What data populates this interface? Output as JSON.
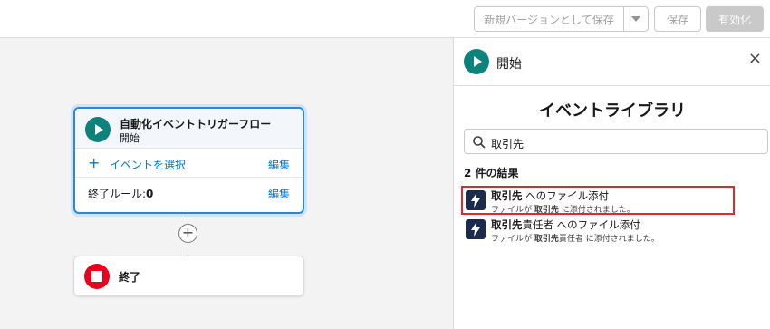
{
  "toolbar": {
    "new_version_label": "新規バージョンとして保存",
    "save_label": "保存",
    "activate_label": "有効化"
  },
  "canvas": {
    "start_node": {
      "title": "自動化イベントトリガーフロー",
      "subtitle": "開始",
      "select_event_label": "イベントを選択",
      "edit_label_1": "編集",
      "end_rule_label": "終了ルール:",
      "end_rule_value": "0",
      "edit_label_2": "編集"
    },
    "add_symbol": "+",
    "end_node": {
      "label": "終了"
    }
  },
  "panel": {
    "title": "開始",
    "close_symbol": "×",
    "library_title": "イベントライブラリ",
    "search_value": "取引先",
    "results_count": "2 件の結果",
    "results": [
      {
        "title_bold": "取引先",
        "title_rest": " へのファイル添付",
        "sub_pre": "ファイルが ",
        "sub_bold": "取引先",
        "sub_post": " に添付されました。",
        "selected": true
      },
      {
        "title_bold": "取引先",
        "title_rest": "責任者 へのファイル添付",
        "sub_pre": "ファイルが ",
        "sub_bold": "取引先",
        "sub_post": "責任者 に添付されました。",
        "selected": false
      }
    ]
  },
  "icons": [
    "play-icon",
    "plus-icon",
    "stop-icon",
    "close-icon",
    "search-icon",
    "lightning-icon",
    "chevron-down-icon"
  ],
  "colors": {
    "accent_blue": "#0176d3",
    "teal": "#0b827c",
    "end_red": "#ea001e",
    "highlight_red": "#e02a2a",
    "event_navy": "#1b2b4e"
  }
}
